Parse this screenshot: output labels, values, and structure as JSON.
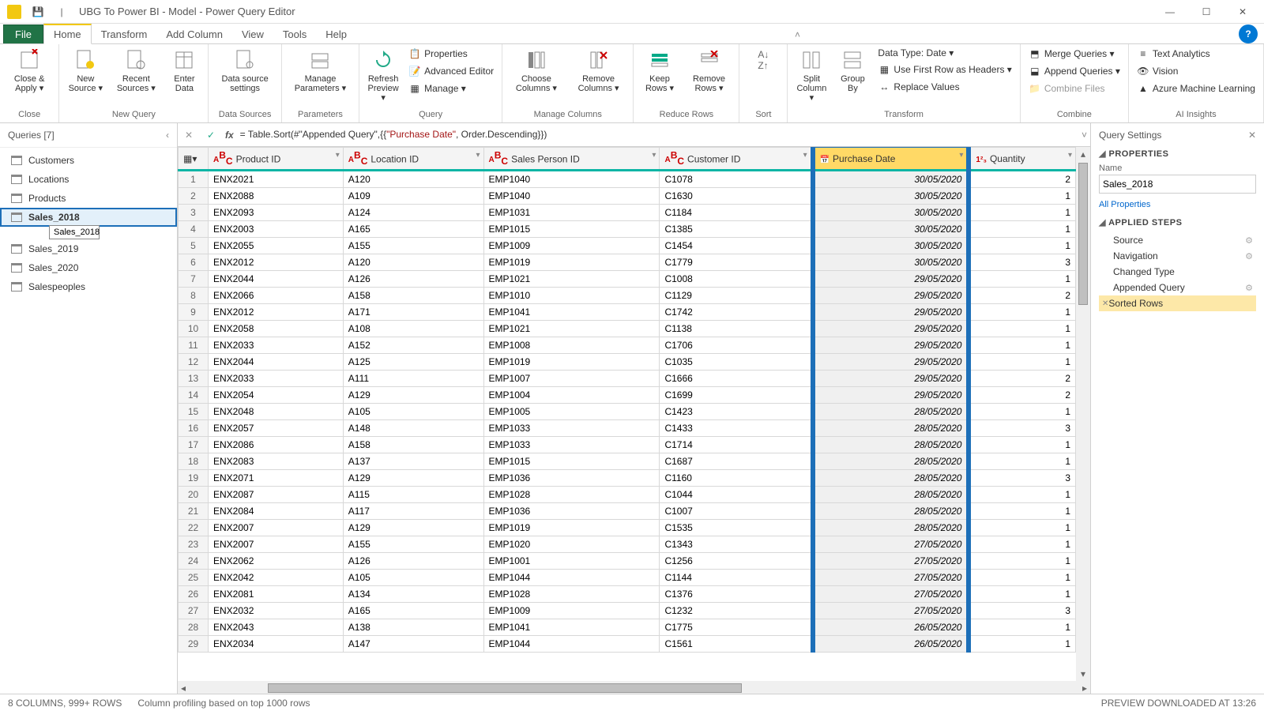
{
  "window": {
    "title": "UBG To Power BI - Model - Power Query Editor"
  },
  "tabs": {
    "file": "File",
    "items": [
      "Home",
      "Transform",
      "Add Column",
      "View",
      "Tools",
      "Help"
    ],
    "active": 0
  },
  "ribbon": {
    "close": {
      "label": "Close &\nApply ▾",
      "group": "Close"
    },
    "newquery": {
      "items": [
        {
          "l": "New\nSource ▾"
        },
        {
          "l": "Recent\nSources ▾"
        },
        {
          "l": "Enter\nData"
        }
      ],
      "group": "New Query"
    },
    "datasources": {
      "l": "Data source\nsettings",
      "group": "Data Sources"
    },
    "params": {
      "l": "Manage\nParameters ▾",
      "group": "Parameters"
    },
    "query": {
      "refresh": "Refresh\nPreview ▾",
      "props": "Properties",
      "adv": "Advanced Editor",
      "manage": "Manage ▾",
      "group": "Query"
    },
    "managecols": {
      "choose": "Choose\nColumns ▾",
      "remove": "Remove\nColumns ▾",
      "group": "Manage Columns"
    },
    "reducerows": {
      "keep": "Keep\nRows ▾",
      "remove": "Remove\nRows ▾",
      "group": "Reduce Rows"
    },
    "sort": {
      "group": "Sort"
    },
    "transform": {
      "split": "Split\nColumn ▾",
      "groupby": "Group\nBy",
      "dtype": "Data Type: Date ▾",
      "firstrow": "Use First Row as Headers ▾",
      "replace": "Replace Values",
      "group": "Transform"
    },
    "combine": {
      "merge": "Merge Queries ▾",
      "append": "Append Queries ▾",
      "files": "Combine Files",
      "group": "Combine"
    },
    "ai": {
      "text": "Text Analytics",
      "vision": "Vision",
      "ml": "Azure Machine Learning",
      "group": "AI Insights"
    }
  },
  "queries": {
    "title": "Queries [7]",
    "items": [
      "Customers",
      "Locations",
      "Products",
      "Sales_2018",
      "Sales_2019",
      "Sales_2020",
      "Salespeoples"
    ],
    "selected": 3,
    "tooltip": "Sales_2018"
  },
  "formula": {
    "prefix": "= Table.Sort(#\"Appended Query\",{{",
    "str": "\"Purchase Date\"",
    "suffix": ", Order.Descending}})"
  },
  "columns": [
    "Product ID",
    "Location ID",
    "Sales Person ID",
    "Customer ID",
    "Purchase Date",
    "Quantity"
  ],
  "chart_data": {
    "type": "table",
    "columns": [
      "Product ID",
      "Location ID",
      "Sales Person ID",
      "Customer ID",
      "Purchase Date",
      "Quantity"
    ],
    "rows": [
      [
        "ENX2021",
        "A120",
        "EMP1040",
        "C1078",
        "30/05/2020",
        "2"
      ],
      [
        "ENX2088",
        "A109",
        "EMP1040",
        "C1630",
        "30/05/2020",
        "1"
      ],
      [
        "ENX2093",
        "A124",
        "EMP1031",
        "C1184",
        "30/05/2020",
        "1"
      ],
      [
        "ENX2003",
        "A165",
        "EMP1015",
        "C1385",
        "30/05/2020",
        "1"
      ],
      [
        "ENX2055",
        "A155",
        "EMP1009",
        "C1454",
        "30/05/2020",
        "1"
      ],
      [
        "ENX2012",
        "A120",
        "EMP1019",
        "C1779",
        "30/05/2020",
        "3"
      ],
      [
        "ENX2044",
        "A126",
        "EMP1021",
        "C1008",
        "29/05/2020",
        "1"
      ],
      [
        "ENX2066",
        "A158",
        "EMP1010",
        "C1129",
        "29/05/2020",
        "2"
      ],
      [
        "ENX2012",
        "A171",
        "EMP1041",
        "C1742",
        "29/05/2020",
        "1"
      ],
      [
        "ENX2058",
        "A108",
        "EMP1021",
        "C1138",
        "29/05/2020",
        "1"
      ],
      [
        "ENX2033",
        "A152",
        "EMP1008",
        "C1706",
        "29/05/2020",
        "1"
      ],
      [
        "ENX2044",
        "A125",
        "EMP1019",
        "C1035",
        "29/05/2020",
        "1"
      ],
      [
        "ENX2033",
        "A111",
        "EMP1007",
        "C1666",
        "29/05/2020",
        "2"
      ],
      [
        "ENX2054",
        "A129",
        "EMP1004",
        "C1699",
        "29/05/2020",
        "2"
      ],
      [
        "ENX2048",
        "A105",
        "EMP1005",
        "C1423",
        "28/05/2020",
        "1"
      ],
      [
        "ENX2057",
        "A148",
        "EMP1033",
        "C1433",
        "28/05/2020",
        "3"
      ],
      [
        "ENX2086",
        "A158",
        "EMP1033",
        "C1714",
        "28/05/2020",
        "1"
      ],
      [
        "ENX2083",
        "A137",
        "EMP1015",
        "C1687",
        "28/05/2020",
        "1"
      ],
      [
        "ENX2071",
        "A129",
        "EMP1036",
        "C1160",
        "28/05/2020",
        "3"
      ],
      [
        "ENX2087",
        "A115",
        "EMP1028",
        "C1044",
        "28/05/2020",
        "1"
      ],
      [
        "ENX2084",
        "A117",
        "EMP1036",
        "C1007",
        "28/05/2020",
        "1"
      ],
      [
        "ENX2007",
        "A129",
        "EMP1019",
        "C1535",
        "28/05/2020",
        "1"
      ],
      [
        "ENX2007",
        "A155",
        "EMP1020",
        "C1343",
        "27/05/2020",
        "1"
      ],
      [
        "ENX2062",
        "A126",
        "EMP1001",
        "C1256",
        "27/05/2020",
        "1"
      ],
      [
        "ENX2042",
        "A105",
        "EMP1044",
        "C1144",
        "27/05/2020",
        "1"
      ],
      [
        "ENX2081",
        "A134",
        "EMP1028",
        "C1376",
        "27/05/2020",
        "1"
      ],
      [
        "ENX2032",
        "A165",
        "EMP1009",
        "C1232",
        "27/05/2020",
        "3"
      ],
      [
        "ENX2043",
        "A138",
        "EMP1041",
        "C1775",
        "26/05/2020",
        "1"
      ],
      [
        "ENX2034",
        "A147",
        "EMP1044",
        "C1561",
        "26/05/2020",
        "1"
      ]
    ]
  },
  "settings": {
    "title": "Query Settings",
    "props": "PROPERTIES",
    "name_label": "Name",
    "name_value": "Sales_2018",
    "all_props": "All Properties",
    "steps_label": "APPLIED STEPS",
    "steps": [
      "Source",
      "Navigation",
      "Changed Type",
      "Appended Query",
      "Sorted Rows"
    ],
    "selected_step": 4
  },
  "status": {
    "left": "8 COLUMNS, 999+ ROWS",
    "mid": "Column profiling based on top 1000 rows",
    "right": "PREVIEW DOWNLOADED AT 13:26"
  }
}
